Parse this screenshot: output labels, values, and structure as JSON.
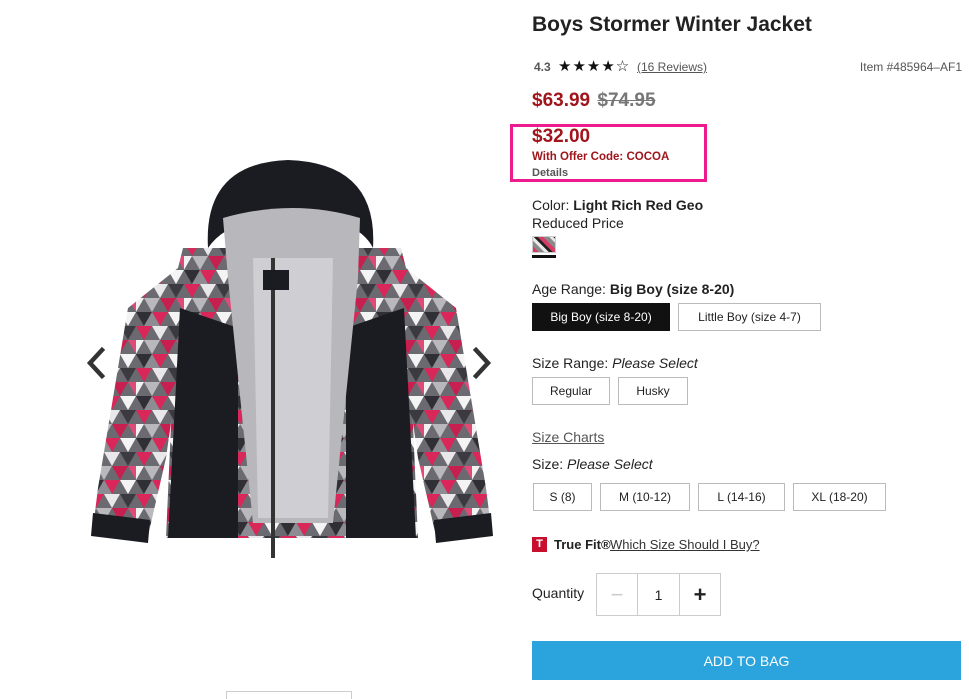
{
  "product": {
    "title": "Boys Stormer Winter Jacket",
    "rating": "4.3",
    "rating_value": 4.3,
    "rating_max": 5,
    "stars": "★★★★☆",
    "reviews_link": "(16 Reviews)",
    "item_number": "Item #485964–AF1"
  },
  "pricing": {
    "sale_price": "$63.99",
    "original_price": "$74.95",
    "offer_price": "$32.00",
    "offer_code_text": "With Offer Code: COCOA",
    "details_link": "Details",
    "highlight_color": "#ee1b8f",
    "price_color": "#a0141b"
  },
  "color": {
    "label": "Color:",
    "value": "Light Rich Red Geo",
    "note": "Reduced Price"
  },
  "age_range": {
    "label": "Age Range:",
    "value": "Big Boy (size 8-20)",
    "options": [
      "Big Boy (size 8-20)",
      "Little Boy (size 4-7)"
    ]
  },
  "size_range": {
    "label": "Size Range:",
    "value": "Please Select",
    "options": [
      "Regular",
      "Husky"
    ]
  },
  "size_charts_link": "Size Charts",
  "size": {
    "label": "Size:",
    "value": "Please Select",
    "options": [
      "S (8)",
      "M (10-12)",
      "L (14-16)",
      "XL (18-20)"
    ]
  },
  "truefit": {
    "logo": "T",
    "brand": "True Fit®",
    "link": "Which Size Should I Buy?"
  },
  "quantity": {
    "label": "Quantity",
    "value": "1",
    "minus": "−",
    "plus": "+"
  },
  "add_to_bag": "ADD TO BAG",
  "icons": {
    "prev": "chevron-left-icon",
    "next": "chevron-right-icon"
  },
  "colors": {
    "button_blue": "#2ba3dc",
    "selected_option": "#111111"
  }
}
